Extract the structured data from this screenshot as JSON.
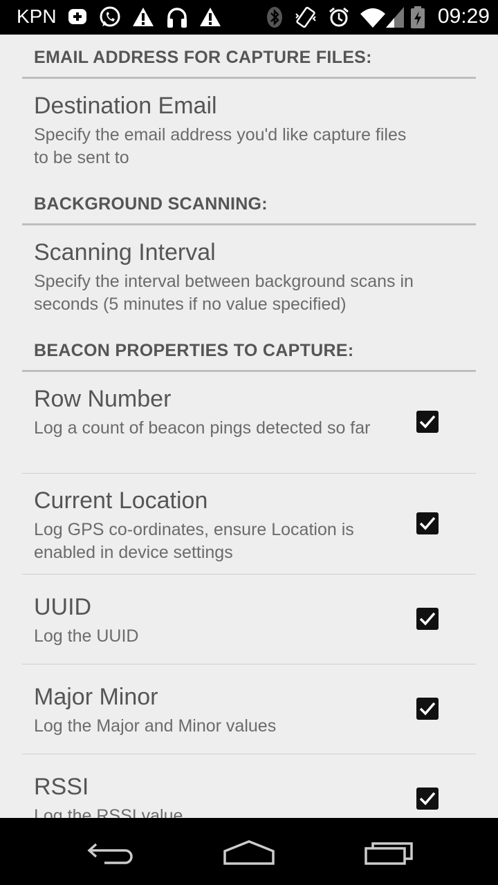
{
  "status_bar": {
    "carrier": "KPN",
    "time": "09:29"
  },
  "sections": {
    "email": {
      "header": "EMAIL ADDRESS FOR CAPTURE FILES:"
    },
    "background": {
      "header": "BACKGROUND SCANNING:"
    },
    "beacon": {
      "header": "BEACON PROPERTIES TO CAPTURE:"
    }
  },
  "prefs": {
    "destination_email": {
      "title": "Destination Email",
      "summary": "Specify the email address you'd like capture files to be sent to"
    },
    "scanning_interval": {
      "title": "Scanning Interval",
      "summary": "Specify the interval between background scans in seconds (5 minutes if no value specified)"
    },
    "row_number": {
      "title": "Row Number",
      "summary": "Log a count of beacon pings detected so far",
      "checked": true
    },
    "current_location": {
      "title": "Current Location",
      "summary": "Log GPS co-ordinates, ensure Location is enabled in device settings",
      "checked": true
    },
    "uuid": {
      "title": "UUID",
      "summary": "Log the UUID",
      "checked": true
    },
    "major_minor": {
      "title": "Major Minor",
      "summary": "Log the Major and Minor values",
      "checked": true
    },
    "rssi": {
      "title": "RSSI",
      "summary": "Log the RSSI value",
      "checked": true
    }
  },
  "icons": {
    "status_left": [
      "notification-plus-icon",
      "whatsapp-icon",
      "warning-icon",
      "headphones-icon",
      "warning-icon"
    ],
    "status_right": [
      "bluetooth-icon",
      "vibrate-icon",
      "alarm-icon",
      "wifi-icon",
      "signal-icon",
      "battery-icon"
    ],
    "nav": [
      "back-icon",
      "home-icon",
      "recents-icon"
    ]
  },
  "colors": {
    "background": "#eeeeee",
    "text_primary": "#555555",
    "text_secondary": "#6b6b6b",
    "divider": "#bdbdbd"
  }
}
